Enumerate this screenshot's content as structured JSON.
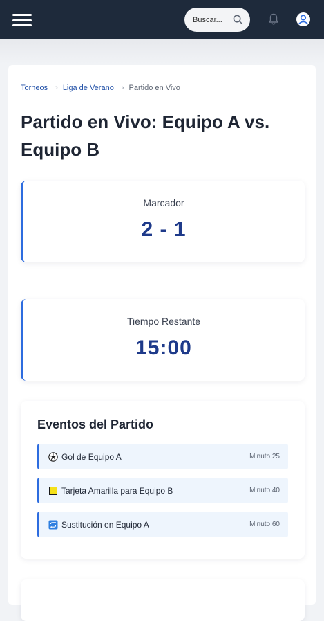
{
  "header": {
    "search_placeholder": "Buscar...",
    "icons": [
      "menu-icon",
      "search-icon",
      "bell-icon",
      "user-icon"
    ]
  },
  "breadcrumb": {
    "items": [
      "Torneos",
      "Liga de Verano"
    ],
    "current": "Partido en Vivo"
  },
  "page": {
    "title": "Partido en Vivo: Equipo A vs. Equipo B"
  },
  "score": {
    "label": "Marcador",
    "value": "2 - 1"
  },
  "timer": {
    "label": "Tiempo Restante",
    "value": "15:00"
  },
  "events": {
    "title": "Eventos del Partido",
    "items": [
      {
        "icon": "soccer-ball-icon",
        "text": "Gol de Equipo A",
        "time": "Minuto 25"
      },
      {
        "icon": "yellow-card-icon",
        "text": "Tarjeta Amarilla para Equipo B",
        "time": "Minuto 40"
      },
      {
        "icon": "substitution-icon",
        "text": "Sustitución en Equipo A",
        "time": "Minuto 60"
      }
    ]
  },
  "colors": {
    "header_bg": "#1e2a3b",
    "accent": "#2d6cdf",
    "value_text": "#1e3a8a",
    "event_bg": "#eef5fd"
  }
}
